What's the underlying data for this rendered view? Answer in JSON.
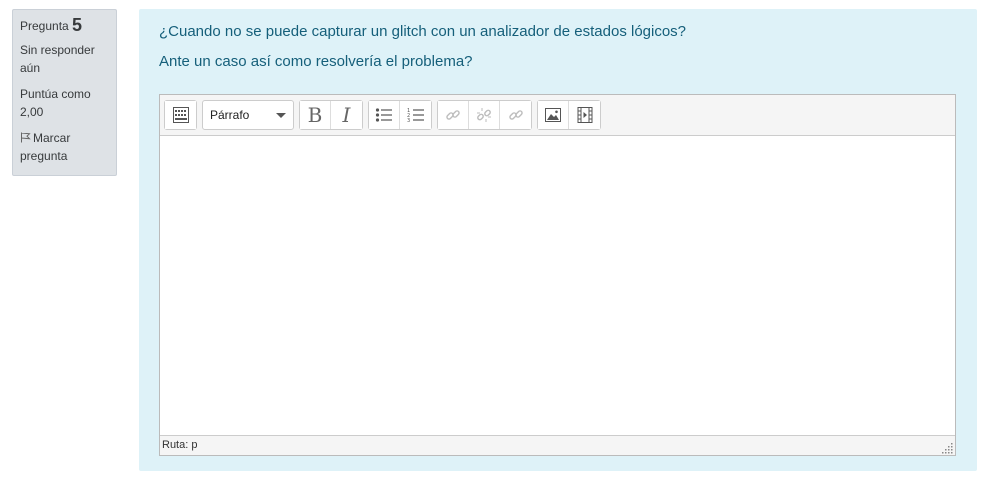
{
  "info": {
    "question_label": "Pregunta",
    "question_number": "5",
    "state": "Sin responder aún",
    "grade": "Puntúa como 2,00",
    "flag_label": "Marcar pregunta"
  },
  "question": {
    "line1": "¿Cuando no se puede capturar un glitch con un analizador de estados lógicos?",
    "line2": "Ante un caso así como resolvería el problema?"
  },
  "editor": {
    "format_select": "Párrafo",
    "bold_glyph": "B",
    "italic_glyph": "I",
    "status_path": "Ruta: p"
  }
}
